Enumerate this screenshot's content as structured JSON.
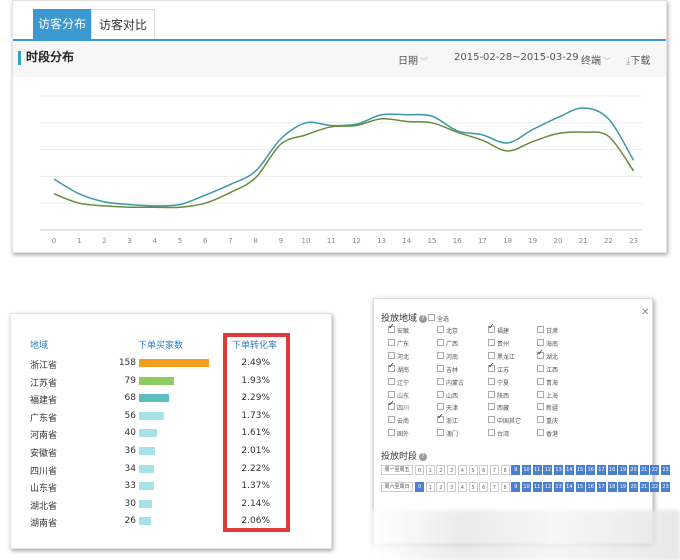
{
  "tabs": [
    {
      "label": "访客分布",
      "active": true
    },
    {
      "label": "访客对比",
      "active": false
    }
  ],
  "section": {
    "title": "时段分布",
    "date_label": "日期",
    "date_range": "2015-02-28~2015-03-29",
    "terminal_label": "终端",
    "download_label": "下载",
    "download_icon": "download-icon",
    "caret_icon": "chevron-down-icon"
  },
  "chart_data": {
    "type": "line",
    "x": [
      0,
      1,
      2,
      3,
      4,
      5,
      6,
      7,
      8,
      9,
      10,
      11,
      12,
      13,
      14,
      15,
      16,
      17,
      18,
      19,
      20,
      21,
      22,
      23
    ],
    "series": [
      {
        "color": "#3a9aa3",
        "values": [
          38,
          27,
          21,
          19,
          18,
          19,
          26,
          34,
          44,
          68,
          80,
          78,
          79,
          86,
          86,
          85,
          74,
          71,
          65,
          75,
          84,
          91,
          83,
          52
        ]
      },
      {
        "color": "#6a8a3c",
        "values": [
          27,
          20,
          18,
          17,
          17,
          17,
          20,
          28,
          39,
          64,
          71,
          77,
          78,
          83,
          81,
          80,
          73,
          67,
          59,
          66,
          72,
          73,
          70,
          44
        ]
      }
    ],
    "xlabel": "",
    "ylabel": "",
    "ylim": [
      0,
      100
    ],
    "grid": true
  },
  "region_table": {
    "headers": [
      "地域",
      "下单买家数",
      "下单转化率"
    ],
    "bar_colors": [
      "#f0a01c",
      "#8fcd64",
      "#5bbfc0",
      "#a7e2e6"
    ],
    "rows": [
      {
        "name": "浙江省",
        "count": 158,
        "rate": "2.49%"
      },
      {
        "name": "江苏省",
        "count": 79,
        "rate": "1.93%"
      },
      {
        "name": "福建省",
        "count": 68,
        "rate": "2.29%"
      },
      {
        "name": "广东省",
        "count": 56,
        "rate": "1.73%"
      },
      {
        "name": "河南省",
        "count": 40,
        "rate": "1.61%"
      },
      {
        "name": "安徽省",
        "count": 36,
        "rate": "2.01%"
      },
      {
        "name": "四川省",
        "count": 34,
        "rate": "2.22%"
      },
      {
        "name": "山东省",
        "count": 33,
        "rate": "1.37%"
      },
      {
        "name": "湖北省",
        "count": 30,
        "rate": "2.14%"
      },
      {
        "name": "湖南省",
        "count": 26,
        "rate": "2.06%"
      }
    ]
  },
  "delivery": {
    "region_title": "投放地域",
    "select_all": "全选",
    "help_icon": "question-icon",
    "close_icon": "close-icon",
    "provinces": [
      {
        "name": "安徽",
        "checked": true
      },
      {
        "name": "北京",
        "checked": false
      },
      {
        "name": "福建",
        "checked": true
      },
      {
        "name": "甘肃",
        "checked": false
      },
      {
        "name": "广东",
        "checked": false
      },
      {
        "name": "广西",
        "checked": false
      },
      {
        "name": "贵州",
        "checked": false
      },
      {
        "name": "海南",
        "checked": false
      },
      {
        "name": "河北",
        "checked": false
      },
      {
        "name": "河南",
        "checked": false
      },
      {
        "name": "黑龙江",
        "checked": false
      },
      {
        "name": "湖北",
        "checked": true
      },
      {
        "name": "湖南",
        "checked": true
      },
      {
        "name": "吉林",
        "checked": false
      },
      {
        "name": "江苏",
        "checked": true
      },
      {
        "name": "江西",
        "checked": false
      },
      {
        "name": "辽宁",
        "checked": false
      },
      {
        "name": "内蒙古",
        "checked": false
      },
      {
        "name": "宁夏",
        "checked": false
      },
      {
        "name": "青海",
        "checked": false
      },
      {
        "name": "山东",
        "checked": false
      },
      {
        "name": "山西",
        "checked": false
      },
      {
        "name": "陕西",
        "checked": false
      },
      {
        "name": "上海",
        "checked": false
      },
      {
        "name": "四川",
        "checked": true
      },
      {
        "name": "天津",
        "checked": false
      },
      {
        "name": "西藏",
        "checked": false
      },
      {
        "name": "新疆",
        "checked": false
      },
      {
        "name": "云南",
        "checked": false
      },
      {
        "name": "浙江",
        "checked": true
      },
      {
        "name": "中国其它",
        "checked": false
      },
      {
        "name": "重庆",
        "checked": false
      },
      {
        "name": "国外",
        "checked": false
      },
      {
        "name": "澳门",
        "checked": false
      },
      {
        "name": "台湾",
        "checked": false
      },
      {
        "name": "香港",
        "checked": false
      }
    ],
    "time_title": "投放时段",
    "time_rows": [
      {
        "label": "周一至周五",
        "hours": [
          "0",
          "1",
          "2",
          "3",
          "4",
          "5",
          "6",
          "7",
          "8",
          "9",
          "10",
          "11",
          "12",
          "13",
          "14",
          "15",
          "16",
          "17",
          "18",
          "19",
          "20",
          "21",
          "22",
          "23"
        ],
        "on": [
          false,
          false,
          false,
          false,
          false,
          false,
          false,
          false,
          false,
          true,
          true,
          true,
          true,
          true,
          true,
          true,
          true,
          true,
          true,
          true,
          true,
          true,
          true,
          true
        ]
      },
      {
        "label": "周六至周日",
        "hours": [
          "0",
          "1",
          "2",
          "3",
          "4",
          "5",
          "6",
          "7",
          "8",
          "9",
          "10",
          "11",
          "12",
          "13",
          "14",
          "15",
          "16",
          "17",
          "18",
          "19",
          "20",
          "21",
          "22",
          "23"
        ],
        "on": [
          true,
          false,
          false,
          false,
          false,
          false,
          false,
          false,
          false,
          true,
          true,
          true,
          true,
          true,
          true,
          true,
          true,
          true,
          true,
          true,
          true,
          true,
          true,
          true
        ]
      }
    ]
  }
}
